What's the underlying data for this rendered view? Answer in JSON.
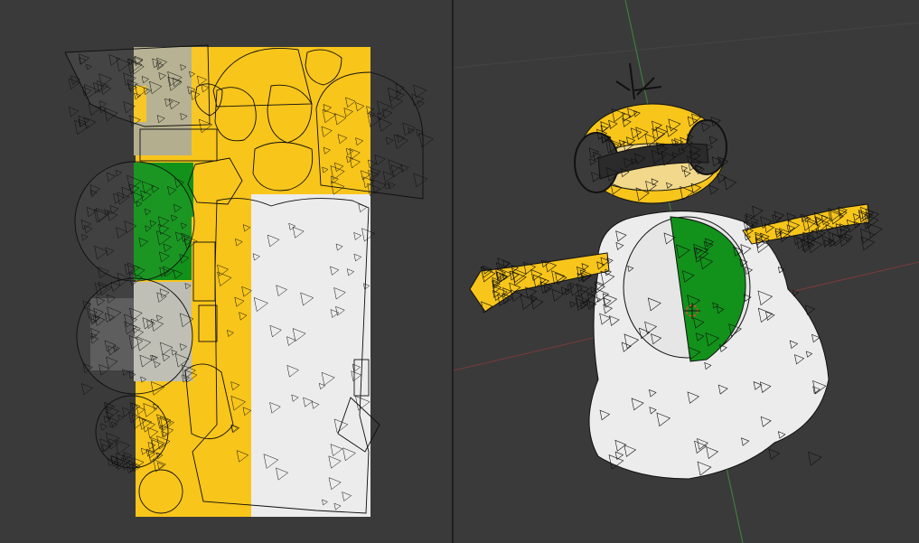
{
  "theme": {
    "editor_bg": "#3a3a3a",
    "divider": "#1f1f1f",
    "texture_yellow": "#f8c51a",
    "texture_green": "#12921b",
    "texture_white": "#ececec",
    "texture_gray": "#8e8e8e",
    "wire": "#0d0d0d",
    "axis_red": "#a33b3b",
    "axis_green": "#4aa84a",
    "cursor": "#e34d2b"
  },
  "uv_editor": {
    "icon": "uv-image-icon",
    "texture": "uv-texture-atlas"
  },
  "viewport": {
    "icon": "3d-viewport-icon",
    "model": "mesh-character",
    "cursor": "3d-cursor-icon"
  }
}
